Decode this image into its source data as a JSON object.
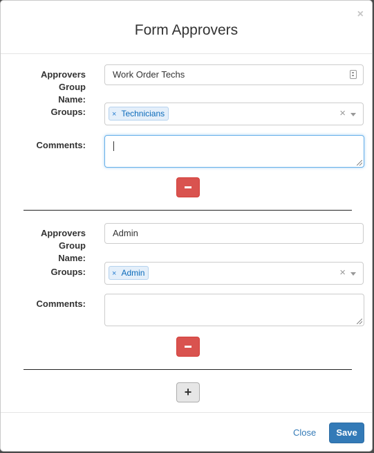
{
  "modal": {
    "title": "Form Approvers",
    "close_icon": "×"
  },
  "groups": [
    {
      "name_label_1": "Approvers Group",
      "name_label_2": "Name:",
      "name_value": "Work Order Techs",
      "groups_label": "Groups:",
      "selected_tags": [
        {
          "remove": "×",
          "label": "Technicians"
        }
      ],
      "clear": "×",
      "comments_label": "Comments:",
      "comments_value": "",
      "remove_icon": "minus-icon"
    },
    {
      "name_label_1": "Approvers Group",
      "name_label_2": "Name:",
      "name_value": "Admin",
      "groups_label": "Groups:",
      "selected_tags": [
        {
          "remove": "×",
          "label": "Admin"
        }
      ],
      "clear": "×",
      "comments_label": "Comments:",
      "comments_value": "",
      "remove_icon": "minus-icon"
    }
  ],
  "add_button": {
    "label": "+",
    "icon": "plus-icon"
  },
  "footer": {
    "close_label": "Close",
    "save_label": "Save"
  },
  "colors": {
    "primary": "#337ab7",
    "danger": "#d9534f",
    "tag_bg": "#e4effa",
    "focus": "#66afe9"
  }
}
